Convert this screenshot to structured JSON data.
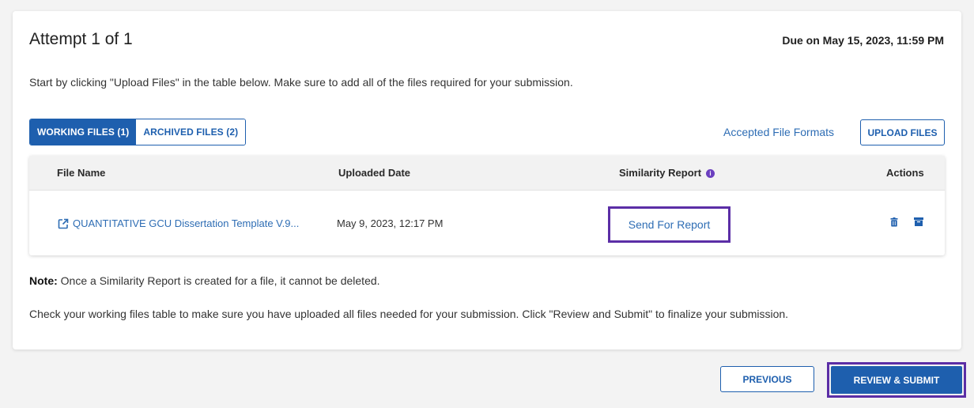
{
  "header": {
    "title": "Attempt 1 of 1",
    "due": "Due on May 15, 2023, 11:59 PM"
  },
  "intro": "Start by clicking \"Upload Files\" in the table below. Make sure to add all of the files required for your submission.",
  "tabs": [
    {
      "label": "WORKING FILES (1)",
      "active": true
    },
    {
      "label": "ARCHIVED FILES (2)",
      "active": false
    }
  ],
  "accepted_formats_link": "Accepted File Formats",
  "upload_button": "UPLOAD FILES",
  "table": {
    "headers": {
      "file_name": "File Name",
      "uploaded_date": "Uploaded Date",
      "similarity_report": "Similarity Report",
      "actions": "Actions"
    },
    "rows": [
      {
        "file_name": "QUANTITATIVE GCU Dissertation Template V.9...",
        "uploaded_date": "May 9, 2023, 12:17 PM",
        "similarity_action": "Send For Report",
        "actions": [
          "trash-icon",
          "archive-icon"
        ]
      }
    ]
  },
  "note": {
    "label": "Note:",
    "text": " Once a Similarity Report is created for a file, it cannot be deleted."
  },
  "check_text": "Check your working files table to make sure you have uploaded all files needed for your submission. Click \"Review and Submit\" to finalize your submission.",
  "footer": {
    "previous": "PREVIOUS",
    "submit": "REVIEW & SUBMIT"
  },
  "colors": {
    "primary": "#1e5fae",
    "link": "#2e6db4",
    "highlight": "#5b2ea6",
    "info": "#6b3fbf"
  }
}
